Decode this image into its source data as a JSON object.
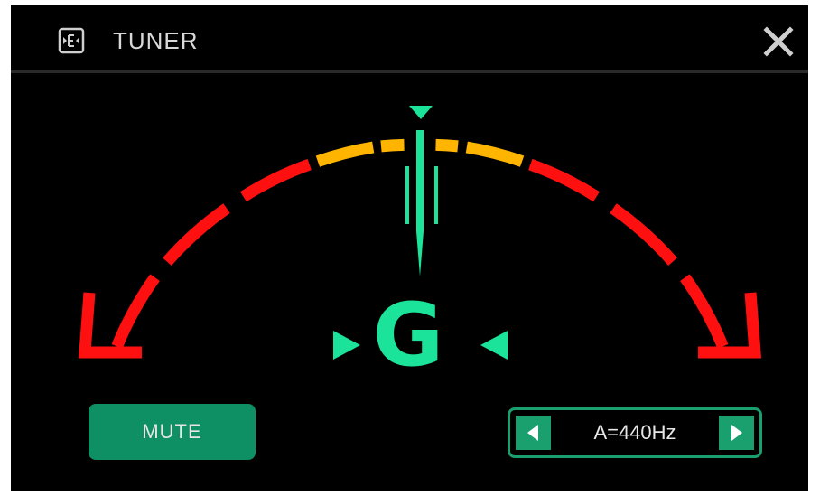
{
  "header": {
    "title": "TUNER",
    "app_icon": "effect-block-icon",
    "close_icon": "close-icon"
  },
  "tuner": {
    "note": "G",
    "cents_offset": 0,
    "in_tune": true
  },
  "controls": {
    "mute_label": "MUTE",
    "reference_pitch": "A=440Hz",
    "decrease_icon": "arrow-left-icon",
    "increase_icon": "arrow-right-icon"
  },
  "colors": {
    "background": "#000000",
    "accent": "#1be39a",
    "button": "#0f8f64",
    "flat_sharp_far": "#ff1010",
    "flat_sharp_near": "#ffb400"
  }
}
